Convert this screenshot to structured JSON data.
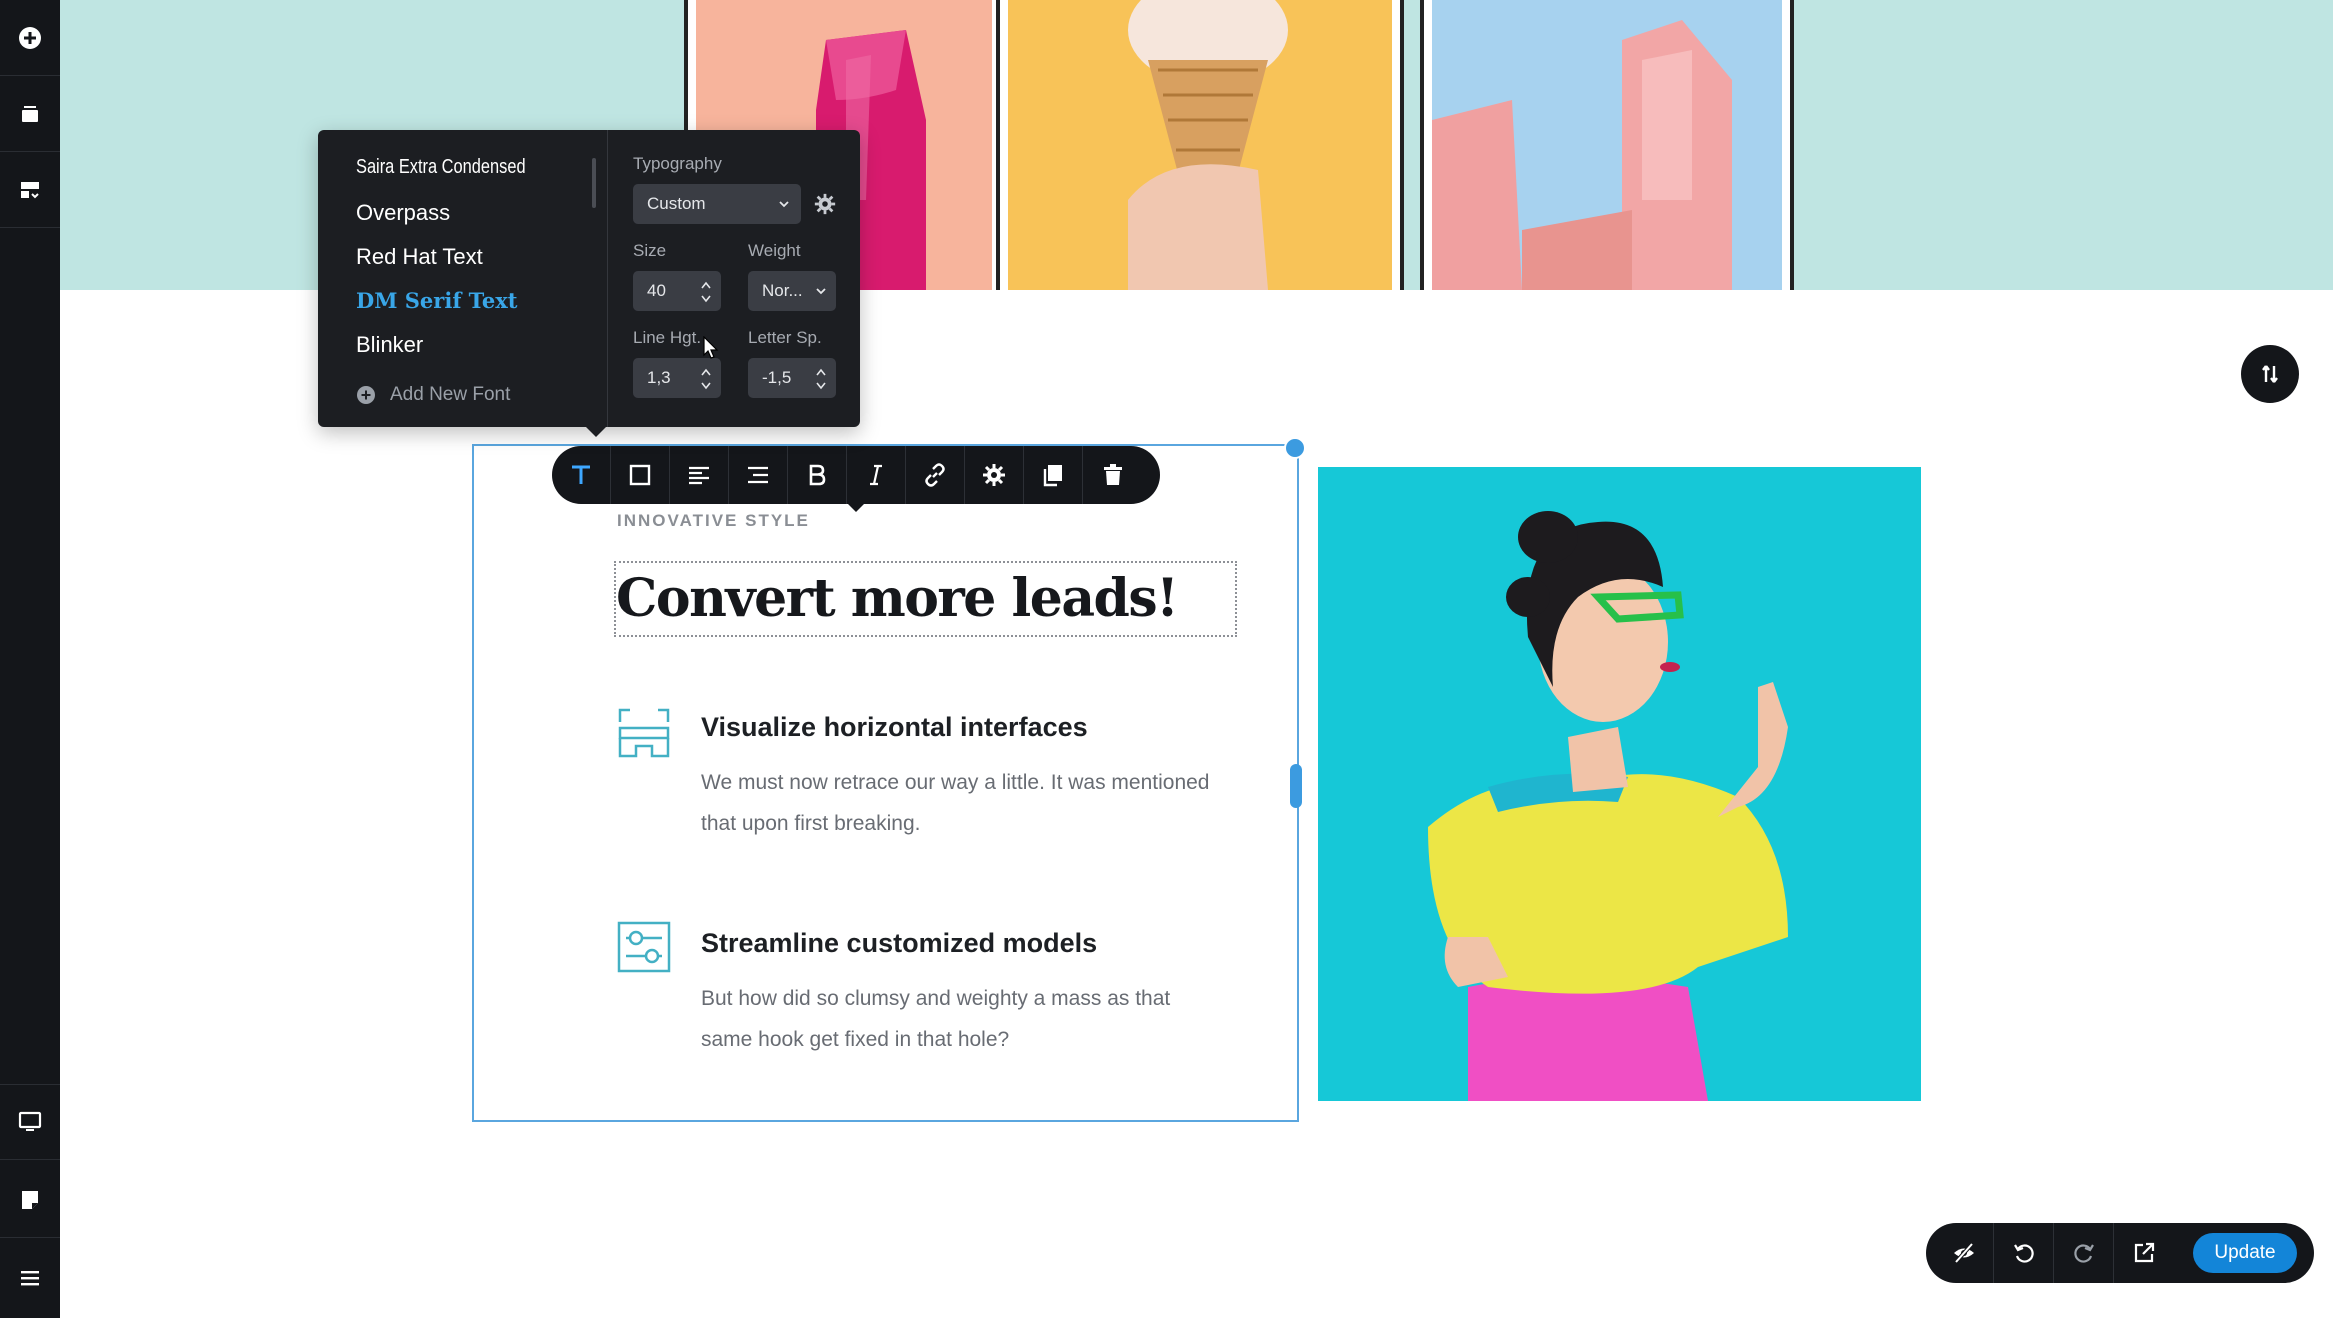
{
  "sidebar": {
    "top_icons": [
      "plus-circle-icon",
      "layers-icon",
      "sections-icon"
    ],
    "bottom_icons": [
      "desktop-icon",
      "page-icon",
      "hamburger-menu-icon"
    ]
  },
  "font_panel": {
    "fonts": [
      "Saira Extra Condensed",
      "Overpass",
      "Red Hat Text",
      "DM Serif Text",
      "Blinker"
    ],
    "selected_font": "DM Serif Text",
    "add_font_label": "Add New Font",
    "typography_label": "Typography",
    "typography_value": "Custom",
    "size_label": "Size",
    "size_value": "40",
    "weight_label": "Weight",
    "weight_value": "Nor...",
    "line_height_label": "Line Hgt.",
    "line_height_value": "1,3",
    "letter_spacing_label": "Letter Sp.",
    "letter_spacing_value": "-1,5"
  },
  "toolbar": {
    "buttons": [
      "text-icon",
      "border-box-icon",
      "align-left-icon",
      "align-center-icon",
      "bold-icon",
      "italic-icon",
      "link-icon",
      "gear-icon",
      "copy-icon",
      "trash-icon"
    ]
  },
  "content": {
    "eyebrow": "INNOVATIVE STYLE",
    "headline": "Convert more leads!",
    "features": [
      {
        "title": "Visualize horizontal interfaces",
        "desc": "We must now retrace our way a little. It was mentioned that upon first breaking.",
        "icon": "glasses-icon"
      },
      {
        "title": "Streamline customized models",
        "desc": "But how did so clumsy and weighty a mass as that same hook get fixed in that hole?",
        "icon": "sliders-icon"
      }
    ]
  },
  "bottom_bar": {
    "icons": [
      "hide-icon",
      "undo-icon",
      "redo-icon",
      "external-link-icon"
    ],
    "update_label": "Update"
  },
  "colors": {
    "accent": "#1385d8",
    "selection": "#5aa6df",
    "dark": "#14161a",
    "top_band": "#bfe5e2",
    "hero_bg": "#15c7d6"
  }
}
